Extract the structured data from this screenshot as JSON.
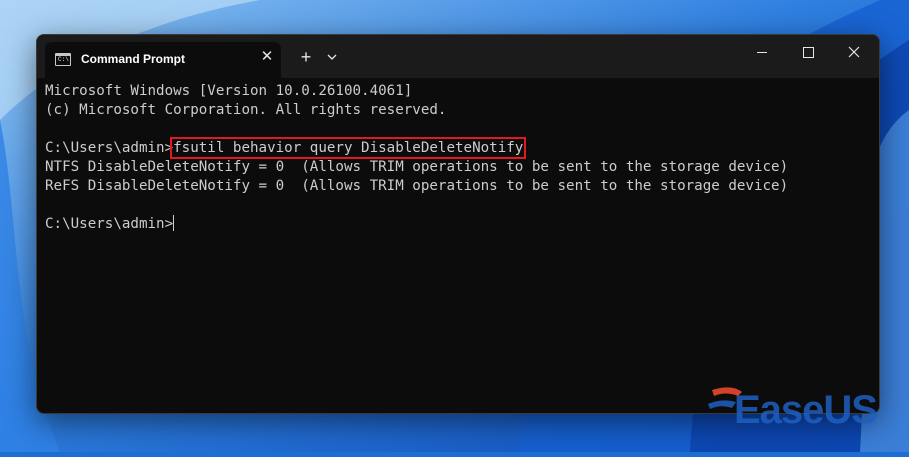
{
  "window": {
    "tab_title": "Command Prompt",
    "tab_icon": "cmd-icon",
    "controls": [
      "minimize-icon",
      "maximize-icon",
      "close-icon"
    ],
    "new_tab_label": "+"
  },
  "terminal": {
    "lines": [
      "Microsoft Windows [Version 10.0.26100.4061]",
      "(c) Microsoft Corporation. All rights reserved.",
      "",
      "",
      "NTFS DisableDeleteNotify = 0  (Allows TRIM operations to be sent to the storage device)",
      "ReFS DisableDeleteNotify = 0  (Allows TRIM operations to be sent to the storage device)",
      "",
      ""
    ],
    "prompt": "C:\\Users\\admin>",
    "command": "fsutil behavior query DisableDeleteNotify",
    "final_prompt": "C:\\Users\\admin>"
  },
  "watermark": {
    "text": "EaseUS"
  },
  "colors": {
    "background": "#0c0c0c",
    "titlebar": "#1b1b1b",
    "text": "#cccccc",
    "highlight": "#e0191e",
    "desktop": "#1d6fd6"
  }
}
